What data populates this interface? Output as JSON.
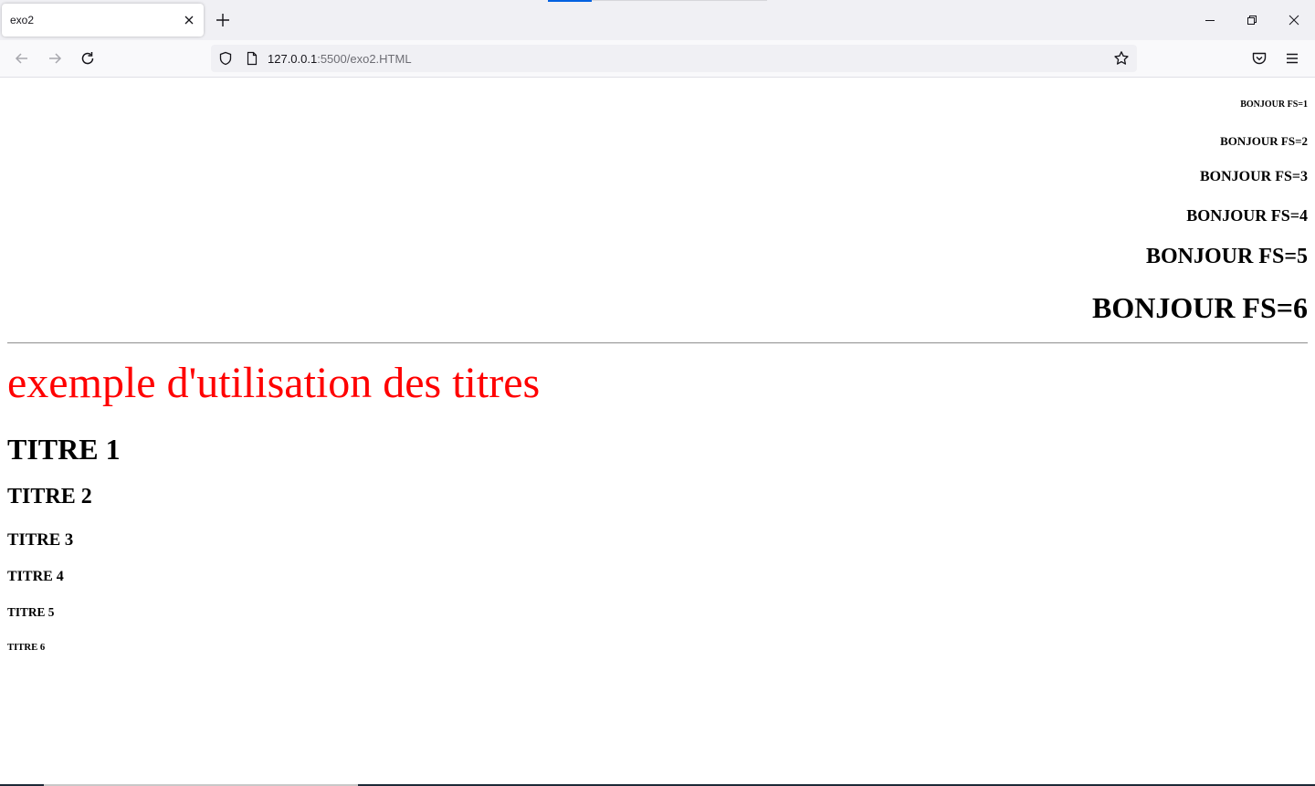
{
  "browser": {
    "tab": {
      "title": "exo2"
    },
    "url": {
      "host": "127.0.0.1",
      "path": ":5500/exo2.HTML"
    },
    "colors": {
      "accent": "#0061e0",
      "chrome_bg": "#f0f0f4",
      "toolbar_bg": "#f9f9fb"
    }
  },
  "page": {
    "bonjour": [
      "BONJOUR FS=1",
      "BONJOUR FS=2",
      "BONJOUR FS=3",
      "BONJOUR FS=4",
      "BONJOUR FS=5",
      "BONJOUR FS=6"
    ],
    "main_title": "exemple d'utilisation des titres",
    "main_title_color": "#ff0000",
    "headings": [
      "TITRE 1",
      "TITRE 2",
      "TITRE 3",
      "TITRE 4",
      "TITRE 5",
      "TITRE 6"
    ]
  }
}
